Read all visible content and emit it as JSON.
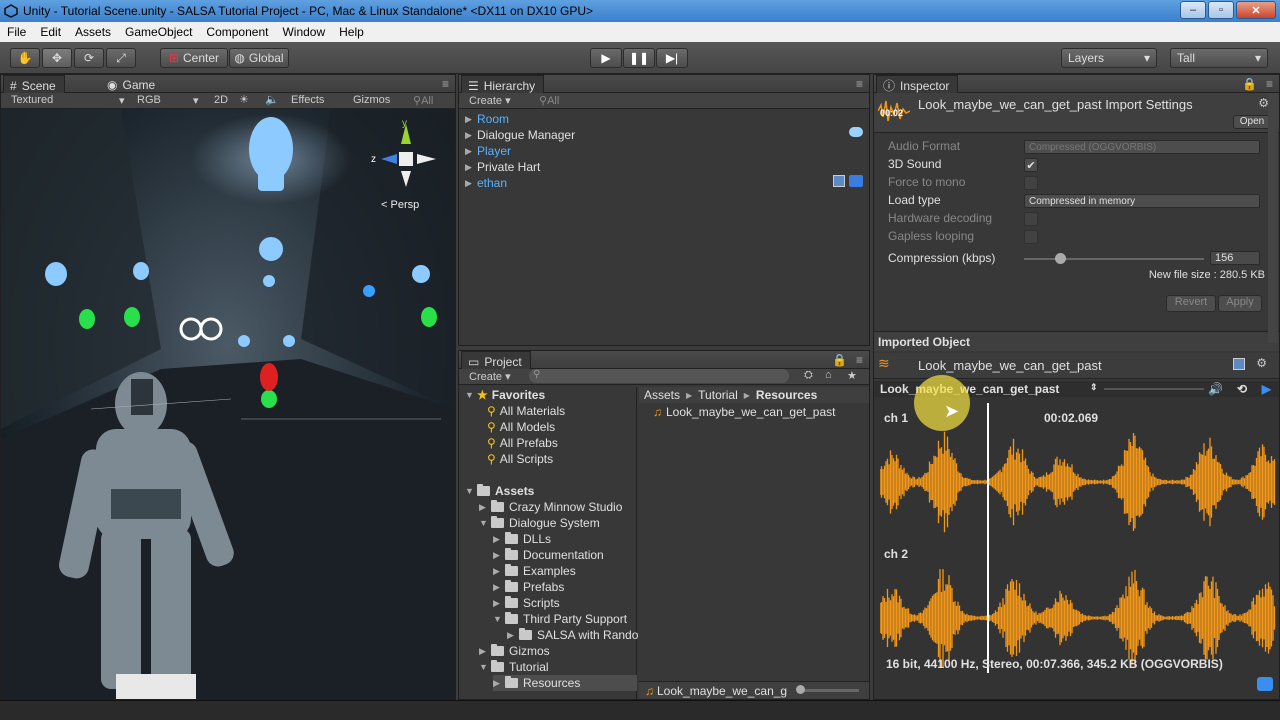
{
  "window": {
    "title": "Unity - Tutorial Scene.unity - SALSA Tutorial Project - PC, Mac & Linux Standalone* <DX11 on DX10 GPU>"
  },
  "menu": [
    "File",
    "Edit",
    "Assets",
    "GameObject",
    "Component",
    "Window",
    "Help"
  ],
  "toolbar": {
    "center": "Center",
    "global": "Global",
    "layers": "Layers",
    "layout": "Tall"
  },
  "scene": {
    "tab_scene": "Scene",
    "tab_game": "Game",
    "shading": "Textured",
    "render": "RGB",
    "mode2d": "2D",
    "effects": "Effects",
    "gizmos": "Gizmos",
    "search_placeholder": "All",
    "persp": "Persp",
    "axis_y": "y",
    "axis_z": "z"
  },
  "hierarchy": {
    "title": "Hierarchy",
    "create": "Create",
    "search_placeholder": "All",
    "items": [
      {
        "label": "Room",
        "prefab": true
      },
      {
        "label": "Dialogue Manager",
        "prefab": false
      },
      {
        "label": "Player",
        "prefab": true
      },
      {
        "label": "Private Hart",
        "prefab": false
      },
      {
        "label": "ethan",
        "prefab": true
      }
    ]
  },
  "project": {
    "title": "Project",
    "create": "Create",
    "favorites_label": "Favorites",
    "favorites": [
      "All Materials",
      "All Models",
      "All Prefabs",
      "All Scripts"
    ],
    "assets_label": "Assets",
    "tree": [
      {
        "label": "Crazy Minnow Studio",
        "depth": 1
      },
      {
        "label": "Dialogue System",
        "depth": 1
      },
      {
        "label": "DLLs",
        "depth": 2
      },
      {
        "label": "Documentation",
        "depth": 2
      },
      {
        "label": "Examples",
        "depth": 2
      },
      {
        "label": "Prefabs",
        "depth": 2
      },
      {
        "label": "Scripts",
        "depth": 2
      },
      {
        "label": "Third Party Support",
        "depth": 2
      },
      {
        "label": "SALSA with Rando",
        "depth": 3
      },
      {
        "label": "Gizmos",
        "depth": 1
      },
      {
        "label": "Tutorial",
        "depth": 1
      },
      {
        "label": "Resources",
        "depth": 2
      }
    ],
    "breadcrumb": [
      "Assets",
      "Tutorial",
      "Resources"
    ],
    "asset": "Look_maybe_we_can_get_past",
    "footer_asset": "Look_maybe_we_can_g"
  },
  "inspector": {
    "title": "Inspector",
    "header": "Look_maybe_we_can_get_past Import Settings",
    "header_time": "00:02",
    "open": "Open",
    "fields": [
      {
        "label": "Audio Format",
        "value": "Compressed (OGGVORBIS)",
        "type": "dropdown",
        "disabled": true
      },
      {
        "label": "3D Sound",
        "value": "✔",
        "type": "checkbox",
        "disabled": false
      },
      {
        "label": "Force to mono",
        "value": "",
        "type": "checkbox",
        "disabled": true
      },
      {
        "label": "Load type",
        "value": "Compressed in memory",
        "type": "dropdown",
        "disabled": false
      },
      {
        "label": "Hardware decoding",
        "value": "",
        "type": "checkbox",
        "disabled": true
      },
      {
        "label": "Gapless looping",
        "value": "",
        "type": "checkbox",
        "disabled": true
      }
    ],
    "compression_label": "Compression (kbps)",
    "compression_value": "156",
    "compression_fraction": 0.2,
    "new_file_size": "New file size : 280.5 KB",
    "revert": "Revert",
    "apply": "Apply",
    "imported_object": "Imported Object",
    "object_name": "Look_maybe_we_can_get_past",
    "preview_title": "Look_maybe_we_can_get_past",
    "ch1": "ch 1",
    "ch2": "ch 2",
    "time": "00:02.069",
    "playhead_fraction": 0.27,
    "info": "16 bit, 44100 Hz, Stereo, 00:07.366, 345.2 KB (OGGVORBIS)"
  },
  "colors": {
    "wave": "#f29718",
    "accent": "#5ab2ff",
    "highlight": "#f5e342"
  }
}
